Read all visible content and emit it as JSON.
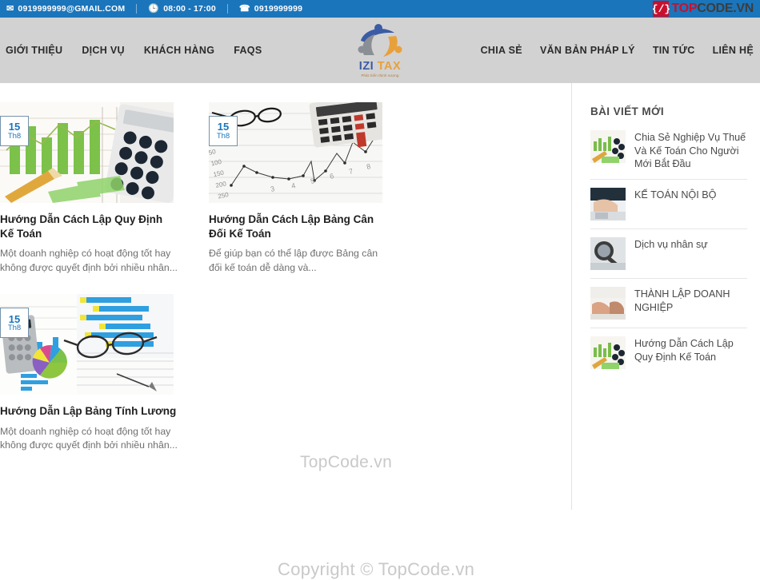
{
  "topbar": {
    "email": "0919999999@GMAIL.COM",
    "email_icon": "envelope-icon",
    "hours": "08:00 - 17:00",
    "hours_icon": "clock-icon",
    "phone": "0919999999",
    "phone_icon": "phone-icon",
    "brand_logo": {
      "mark": "{/}",
      "text_a": "TOP",
      "text_b": "CODE.VN"
    }
  },
  "header": {
    "nav_left": [
      {
        "label": "GIỚI THIỆU"
      },
      {
        "label": "DỊCH VỤ"
      },
      {
        "label": "KHÁCH HÀNG"
      },
      {
        "label": "FAQS"
      }
    ],
    "nav_right": [
      {
        "label": "CHIA SẺ"
      },
      {
        "label": "VĂN BẢN PHÁP LÝ"
      },
      {
        "label": "TIN TỨC"
      },
      {
        "label": "LIÊN HỆ"
      }
    ],
    "brand": {
      "name_a": "IZI",
      "name_b": "TAX",
      "tagline": "Phát triển thịnh vượng"
    }
  },
  "main": {
    "cards": [
      {
        "day": "15",
        "month": "Th8",
        "title": "Hướng Dẫn Cách Lập Quy Định Kế Toán",
        "excerpt": "Một doanh nghiệp có hoạt động tốt hay không được quyết định bởi nhiều nhân..."
      },
      {
        "day": "15",
        "month": "Th8",
        "title": "Hướng Dẫn Cách Lập Bảng Cân Đối Kế Toán",
        "excerpt": "Để giúp bạn có thể lập được Bảng cân đối kế toán dễ dàng và..."
      },
      {
        "day": "15",
        "month": "Th8",
        "title": "Hướng Dẫn Lập Bảng Tính Lương",
        "excerpt": "Một doanh nghiệp có hoạt động tốt hay không được quyết định bởi nhiều nhân..."
      }
    ]
  },
  "sidebar": {
    "heading": "BÀI VIẾT MỚI",
    "items": [
      {
        "title": "Chia Sẻ Nghiệp Vụ Thuế Và Kế Toán Cho Người Mới Bắt Đầu"
      },
      {
        "title": "KẾ TOÁN NỘI BỘ"
      },
      {
        "title": "Dịch vụ nhân sự"
      },
      {
        "title": "THÀNH LẬP DOANH NGHIỆP"
      },
      {
        "title": "Hướng Dẫn Cách Lập Quy Định Kế Toán"
      }
    ]
  },
  "watermarks": {
    "middle": "TopCode.vn",
    "bottom": "Copyright © TopCode.vn"
  },
  "colors": {
    "topbar_bg": "#1b75bb",
    "nav_bg": "#d2d2d2",
    "accent_red": "#c8102e",
    "badge_blue": "#1b75bb",
    "brand_blue": "#3b5ba5",
    "brand_orange": "#e8a13a"
  }
}
